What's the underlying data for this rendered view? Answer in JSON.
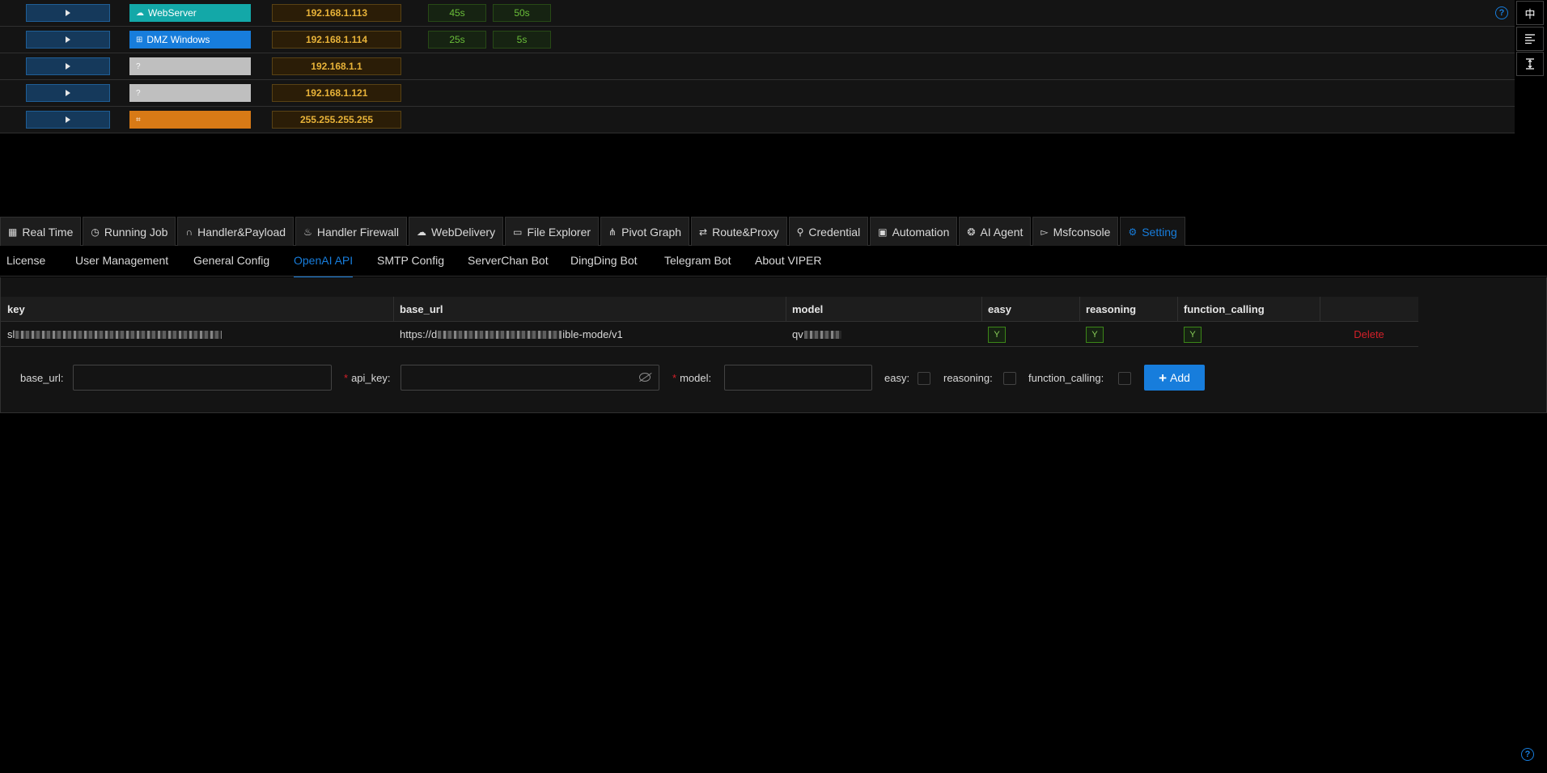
{
  "hosts": [
    {
      "os_label": "WebServer",
      "os_icon": "cloud-icon",
      "os_color": "#13a8a8",
      "ip": "192.168.1.113",
      "tags": [
        "45s",
        "50s"
      ]
    },
    {
      "os_label": "DMZ Windows",
      "os_icon": "windows-icon",
      "os_color": "#177ddc",
      "ip": "192.168.1.114",
      "tags": [
        "25s",
        "5s"
      ]
    },
    {
      "os_label": "",
      "os_icon": "question-icon",
      "os_color": "#bfbfbf",
      "ip": "192.168.1.1",
      "tags": []
    },
    {
      "os_label": "",
      "os_icon": "question-icon",
      "os_color": "#bfbfbf",
      "ip": "192.168.1.121",
      "tags": []
    },
    {
      "os_label": "",
      "os_icon": "network-icon",
      "os_color": "#d87a16",
      "ip": "255.255.255.255",
      "tags": []
    }
  ],
  "side_toolbar": {
    "lang_label": "中"
  },
  "main_tabs": [
    {
      "label": "Real Time",
      "icon": "dashboard-icon"
    },
    {
      "label": "Running Job",
      "icon": "clock-icon"
    },
    {
      "label": "Handler&Payload",
      "icon": "headphones-icon"
    },
    {
      "label": "Handler Firewall",
      "icon": "fire-icon"
    },
    {
      "label": "WebDelivery",
      "icon": "cloud-upload-icon"
    },
    {
      "label": "File Explorer",
      "icon": "folder-icon"
    },
    {
      "label": "Pivot Graph",
      "icon": "graph-icon"
    },
    {
      "label": "Route&Proxy",
      "icon": "route-icon"
    },
    {
      "label": "Credential",
      "icon": "key-icon"
    },
    {
      "label": "Automation",
      "icon": "robot-icon"
    },
    {
      "label": "AI Agent",
      "icon": "openai-icon"
    },
    {
      "label": "Msfconsole",
      "icon": "terminal-icon"
    },
    {
      "label": "Setting",
      "icon": "gear-icon"
    }
  ],
  "sub_tabs": [
    "License",
    "User Management",
    "General Config",
    "OpenAI API",
    "SMTP Config",
    "ServerChan Bot",
    "DingDing Bot",
    "Telegram Bot",
    "About VIPER"
  ],
  "table": {
    "headers": [
      "key",
      "base_url",
      "model",
      "easy",
      "reasoning",
      "function_calling"
    ],
    "rows": [
      {
        "key_prefix": "sl",
        "base_url_prefix": "https://d",
        "base_url_suffix": "ible-mode/v1",
        "model_prefix": "qv",
        "easy": "Y",
        "reasoning": "Y",
        "function_calling": "Y",
        "action": "Delete"
      }
    ]
  },
  "form": {
    "base_url_label": "base_url",
    "api_key_label": "api_key",
    "model_label": "model",
    "easy_label": "easy",
    "reasoning_label": "reasoning",
    "function_calling_label": "function_calling",
    "colon": ":",
    "add_label": "Add"
  }
}
